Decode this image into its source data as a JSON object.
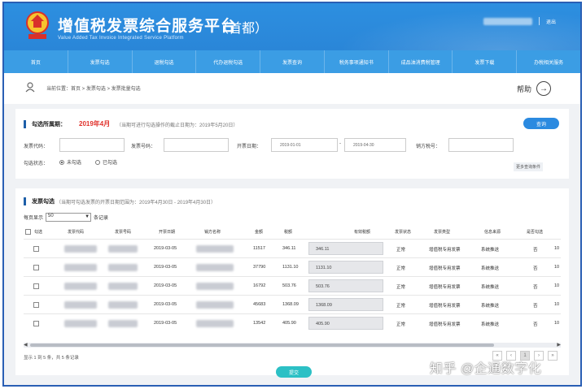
{
  "header": {
    "title": "增值税发票综合服务平台",
    "subtitle": "（首都）",
    "title_en": "Value Added Tax Invoice Integrated Service Platform",
    "logout": "退出"
  },
  "nav": [
    "首页",
    "发票勾选",
    "退税勾选",
    "代办退税勾选",
    "发票查询",
    "税务事项通知书",
    "成品油消费税管理",
    "发票下载",
    "办税相关服务"
  ],
  "breadcrumb": {
    "text": "当前位置：首页 > 发票勾选 > 发票批量勾选",
    "help": "帮助"
  },
  "query": {
    "section_title": "勾选所属期：",
    "period": "2019年4月",
    "period_note": "（当期可进行勾选操作的截止日期为：2019年5月20日）",
    "query_button": "查询",
    "invoice_code_label": "发票代码：",
    "invoice_no_label": "发票号码：",
    "date_label": "开票日期：",
    "date_from": "2019-01-01",
    "date_to": "2019-04-30",
    "seller_tax_label": "销方税号：",
    "status_label": "勾选状态：",
    "status_options": [
      "未勾选",
      "已勾选"
    ],
    "more_conditions": "更多查询条件"
  },
  "list": {
    "section_title": "发票勾选",
    "note": "（当期可勾选发票的开票日期范围为：2019年4月30日 - 2019年4月30日）",
    "page_size_label": "每页显示",
    "page_size": "50",
    "page_size_suffix": "条记录",
    "columns": [
      "勾选",
      "发票代码",
      "发票号码",
      "开票日期",
      "销方名称",
      "金额",
      "税额",
      "有效税额",
      "发票状态",
      "发票类型",
      "信息来源",
      "是否勾选",
      ""
    ],
    "rows": [
      {
        "date": "2019-03-05",
        "amount": "11517",
        "tax": "346.11",
        "valid_tax": "346.11",
        "status": "正常",
        "type": "增值税专用发票",
        "source": "系统推送",
        "checked": "否",
        "extra": "10"
      },
      {
        "date": "2019-03-05",
        "amount": "37790",
        "tax": "1131.10",
        "valid_tax": "1131.10",
        "status": "正常",
        "type": "增值税专用发票",
        "source": "系统推送",
        "checked": "否",
        "extra": "10"
      },
      {
        "date": "2019-03-05",
        "amount": "16792",
        "tax": "503.76",
        "valid_tax": "503.76",
        "status": "正常",
        "type": "增值税专用发票",
        "source": "系统推送",
        "checked": "否",
        "extra": "10"
      },
      {
        "date": "2019-03-05",
        "amount": "45683",
        "tax": "1368.09",
        "valid_tax": "1368.09",
        "status": "正常",
        "type": "增值税专用发票",
        "source": "系统推送",
        "checked": "否",
        "extra": "10"
      },
      {
        "date": "2019-03-05",
        "amount": "13542",
        "tax": "405.90",
        "valid_tax": "405.90",
        "status": "正常",
        "type": "增值税专用发票",
        "source": "系统推送",
        "checked": "否",
        "extra": "10"
      }
    ],
    "total_text": "显示 1 到 5 条，共 5 条记录",
    "pager": [
      "«",
      "‹",
      "1",
      "›",
      "»"
    ],
    "submit": "提交"
  },
  "watermark": "知乎 @企通数字化",
  "colors": {
    "header_bg": "#2a86d8",
    "nav_bg": "#3b9de4",
    "accent": "#2b8ae0",
    "period_red": "#e0302a",
    "submit": "#2cc0c5"
  }
}
